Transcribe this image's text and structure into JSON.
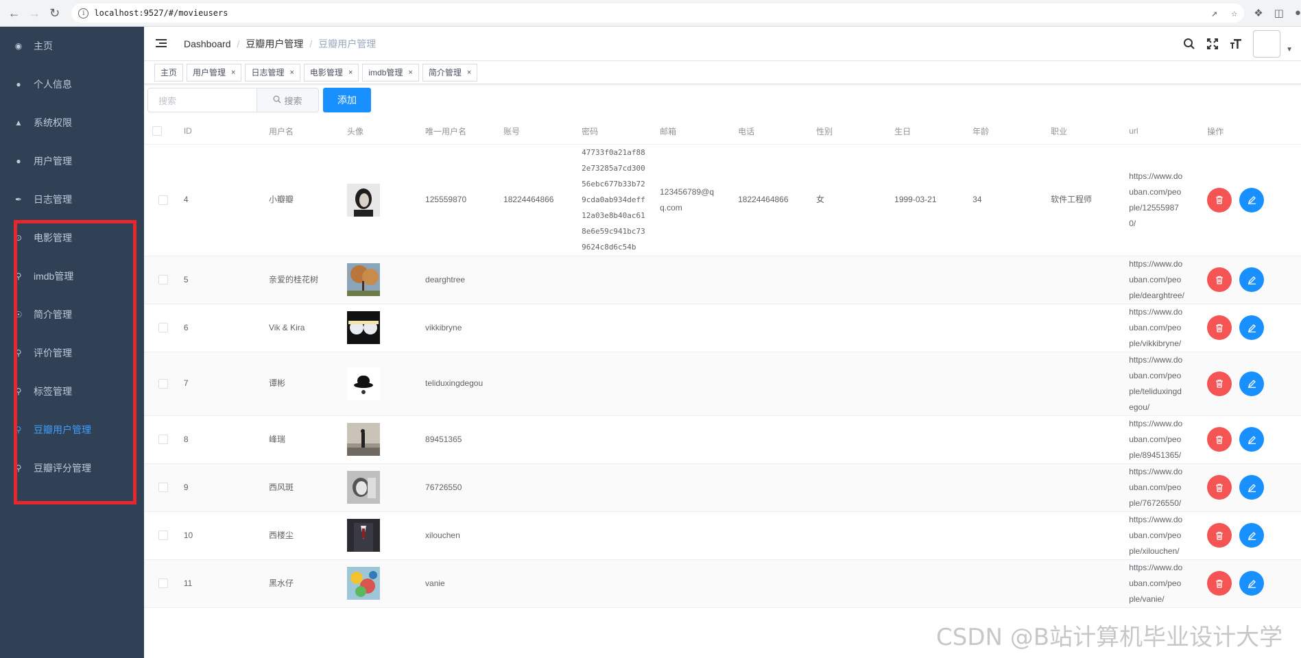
{
  "browser": {
    "url": "localhost:9527/#/movieusers"
  },
  "sidebar": {
    "items": [
      {
        "label": "主页",
        "icon": "dashboard-icon",
        "active": false
      },
      {
        "label": "个人信息",
        "icon": "user-icon",
        "active": false
      },
      {
        "label": "系统权限",
        "icon": "peoples-icon",
        "active": false
      },
      {
        "label": "用户管理",
        "icon": "user-group-icon",
        "active": false
      },
      {
        "label": "日志管理",
        "icon": "feather-icon",
        "active": false
      },
      {
        "label": "电影管理",
        "icon": "film-icon",
        "active": false
      },
      {
        "label": "imdb管理",
        "icon": "pin-icon",
        "active": false
      },
      {
        "label": "简介管理",
        "icon": "info-icon",
        "active": false
      },
      {
        "label": "评价管理",
        "icon": "comment-icon",
        "active": false
      },
      {
        "label": "标签管理",
        "icon": "tag-icon",
        "active": false
      },
      {
        "label": "豆瓣用户管理",
        "icon": "user-icon",
        "active": true
      },
      {
        "label": "豆瓣评分管理",
        "icon": "star-icon",
        "active": false
      }
    ]
  },
  "breadcrumb": [
    "Dashboard",
    "豆瓣用户管理",
    "豆瓣用户管理"
  ],
  "tags": [
    {
      "label": "主页",
      "closable": false
    },
    {
      "label": "用户管理",
      "closable": true
    },
    {
      "label": "日志管理",
      "closable": true
    },
    {
      "label": "电影管理",
      "closable": true
    },
    {
      "label": "imdb管理",
      "closable": true
    },
    {
      "label": "简介管理",
      "closable": true
    }
  ],
  "toolbar": {
    "search_placeholder": "搜索",
    "search_button": "搜索",
    "add_button": "添加"
  },
  "table": {
    "headers": [
      "ID",
      "用户名",
      "头像",
      "唯一用户名",
      "账号",
      "密码",
      "邮箱",
      "电话",
      "性别",
      "生日",
      "年龄",
      "职业",
      "url",
      "操作"
    ],
    "rows": [
      {
        "id": "4",
        "username": "小瓣瓣",
        "avatar": "portrait-bw",
        "unique": "125559870",
        "account": "18224464866",
        "password": "47733f0a21af882e73285a7cd30056ebc677b33b729cda0ab934deff12a03e8b40ac618e6e59c941bc739624c8d6c54b",
        "email": "123456789@qq.com",
        "phone": "18224464866",
        "gender": "女",
        "birthday": "1999-03-21",
        "age": "34",
        "job": "软件工程师",
        "url": "https://www.douban.com/people/125559870/"
      },
      {
        "id": "5",
        "username": "亲爱的桂花树",
        "avatar": "tree",
        "unique": "dearghtree",
        "account": "",
        "password": "",
        "email": "",
        "phone": "",
        "gender": "",
        "birthday": "",
        "age": "",
        "job": "",
        "url": "https://www.douban.com/people/dearghtree/"
      },
      {
        "id": "6",
        "username": "Vik & Kira",
        "avatar": "twins",
        "unique": "vikkibryne",
        "account": "",
        "password": "",
        "email": "",
        "phone": "",
        "gender": "",
        "birthday": "",
        "age": "",
        "job": "",
        "url": "https://www.douban.com/people/vikkibryne/"
      },
      {
        "id": "7",
        "username": "谭彬",
        "avatar": "hat",
        "unique": "teliduxingdegou",
        "account": "",
        "password": "",
        "email": "",
        "phone": "",
        "gender": "",
        "birthday": "",
        "age": "",
        "job": "",
        "url": "https://www.douban.com/people/teliduxingdegou/"
      },
      {
        "id": "8",
        "username": "峰瑞",
        "avatar": "figure",
        "unique": "89451365",
        "account": "",
        "password": "",
        "email": "",
        "phone": "",
        "gender": "",
        "birthday": "",
        "age": "",
        "job": "",
        "url": "https://www.douban.com/people/89451365/"
      },
      {
        "id": "9",
        "username": "西风斑",
        "avatar": "face-bw",
        "unique": "76726550",
        "account": "",
        "password": "",
        "email": "",
        "phone": "",
        "gender": "",
        "birthday": "",
        "age": "",
        "job": "",
        "url": "https://www.douban.com/people/76726550/"
      },
      {
        "id": "10",
        "username": "西楼尘",
        "avatar": "suit",
        "unique": "xilouchen",
        "account": "",
        "password": "",
        "email": "",
        "phone": "",
        "gender": "",
        "birthday": "",
        "age": "",
        "job": "",
        "url": "https://www.douban.com/people/xilouchen/"
      },
      {
        "id": "11",
        "username": "黑水仔",
        "avatar": "colorful",
        "unique": "vanie",
        "account": "",
        "password": "",
        "email": "",
        "phone": "",
        "gender": "",
        "birthday": "",
        "age": "",
        "job": "",
        "url": "https://www.douban.com/people/vanie/"
      }
    ]
  },
  "watermark": "CSDN @B站计算机毕业设计大学",
  "colors": {
    "sidebar_bg": "#304156",
    "sidebar_text": "#bfcbd9",
    "active": "#409EFF",
    "primary": "#1890ff",
    "danger": "#f45454",
    "highlight": "#e8272d"
  }
}
